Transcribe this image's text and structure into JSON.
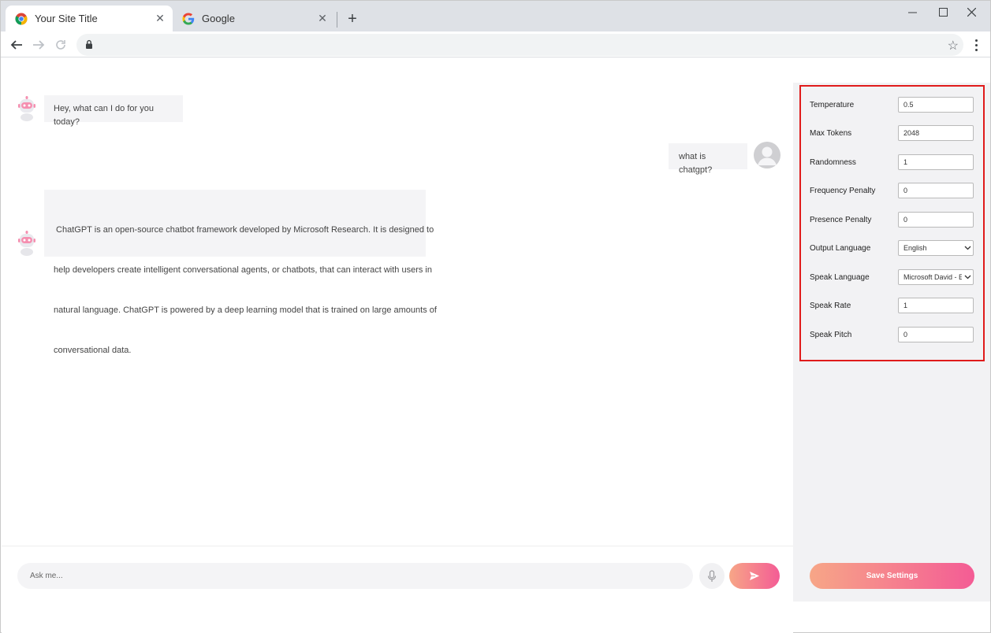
{
  "browser": {
    "tabs": [
      {
        "title": "Your Site Title",
        "icon": "chrome-icon",
        "active": true
      },
      {
        "title": "Google",
        "icon": "google-icon",
        "active": false
      }
    ],
    "address": ""
  },
  "chat": {
    "messages": [
      {
        "role": "bot",
        "text": "Hey, what can I do for you today?"
      },
      {
        "role": "user",
        "text": "what is chatgpt?"
      },
      {
        "role": "bot",
        "lines": [
          " ChatGPT is an open-source chatbot framework developed by Microsoft Research. It is designed to",
          "help developers create intelligent conversational agents, or chatbots, that can interact with users in",
          "natural language. ChatGPT is powered by a deep learning model that is trained on large amounts of",
          "conversational data."
        ]
      }
    ],
    "input_placeholder": "Ask me..."
  },
  "settings": {
    "temperature": {
      "label": "Temperature",
      "value": "0.5"
    },
    "max_tokens": {
      "label": "Max Tokens",
      "value": "2048"
    },
    "randomness": {
      "label": "Randomness",
      "value": "1"
    },
    "frequency_penalty": {
      "label": "Frequency Penalty",
      "value": "0"
    },
    "presence_penalty": {
      "label": "Presence Penalty",
      "value": "0"
    },
    "output_language": {
      "label": "Output Language",
      "value": "English"
    },
    "speak_language": {
      "label": "Speak Language",
      "value": "Microsoft David - E"
    },
    "speak_rate": {
      "label": "Speak Rate",
      "value": "1"
    },
    "speak_pitch": {
      "label": "Speak Pitch",
      "value": "0"
    },
    "save_label": "Save Settings"
  },
  "colors": {
    "accent_gradient_start": "#f7a687",
    "accent_gradient_end": "#f45c95",
    "highlight_border": "#e01b1b",
    "panel_bg": "#f2f2f4",
    "bubble_bg": "#f4f4f6"
  }
}
